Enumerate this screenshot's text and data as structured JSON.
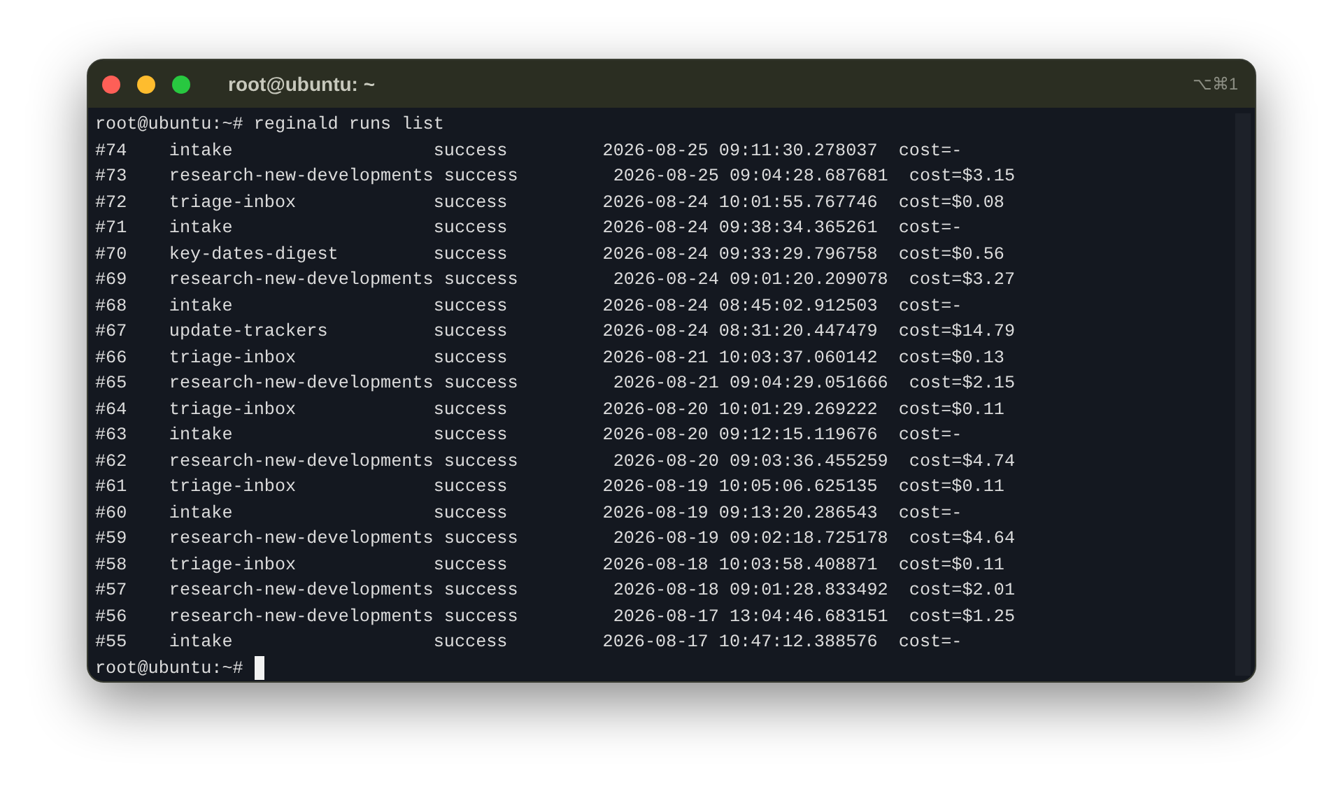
{
  "window": {
    "title": "root@ubuntu: ~",
    "shortcut": "⌥⌘1"
  },
  "terminal": {
    "lines": [
      "root@ubuntu:~# reginald runs list",
      "#74    intake                   success         2026-08-25 09:11:30.278037  cost=-",
      "#73    research-new-developments success         2026-08-25 09:04:28.687681  cost=$3.15",
      "#72    triage-inbox             success         2026-08-24 10:01:55.767746  cost=$0.08",
      "#71    intake                   success         2026-08-24 09:38:34.365261  cost=-",
      "#70    key-dates-digest         success         2026-08-24 09:33:29.796758  cost=$0.56",
      "#69    research-new-developments success         2026-08-24 09:01:20.209078  cost=$3.27",
      "#68    intake                   success         2026-08-24 08:45:02.912503  cost=-",
      "#67    update-trackers          success         2026-08-24 08:31:20.447479  cost=$14.79",
      "#66    triage-inbox             success         2026-08-21 10:03:37.060142  cost=$0.13",
      "#65    research-new-developments success         2026-08-21 09:04:29.051666  cost=$2.15",
      "#64    triage-inbox             success         2026-08-20 10:01:29.269222  cost=$0.11",
      "#63    intake                   success         2026-08-20 09:12:15.119676  cost=-",
      "#62    research-new-developments success         2026-08-20 09:03:36.455259  cost=$4.74",
      "#61    triage-inbox             success         2026-08-19 10:05:06.625135  cost=$0.11",
      "#60    intake                   success         2026-08-19 09:13:20.286543  cost=-",
      "#59    research-new-developments success         2026-08-19 09:02:18.725178  cost=$4.64",
      "#58    triage-inbox             success         2026-08-18 10:03:58.408871  cost=$0.11",
      "#57    research-new-developments success         2026-08-18 09:01:28.833492  cost=$2.01",
      "#56    research-new-developments success         2026-08-17 13:04:46.683151  cost=$1.25",
      "#55    intake                   success         2026-08-17 10:47:12.388576  cost=-"
    ],
    "prompt": "root@ubuntu:~#"
  }
}
